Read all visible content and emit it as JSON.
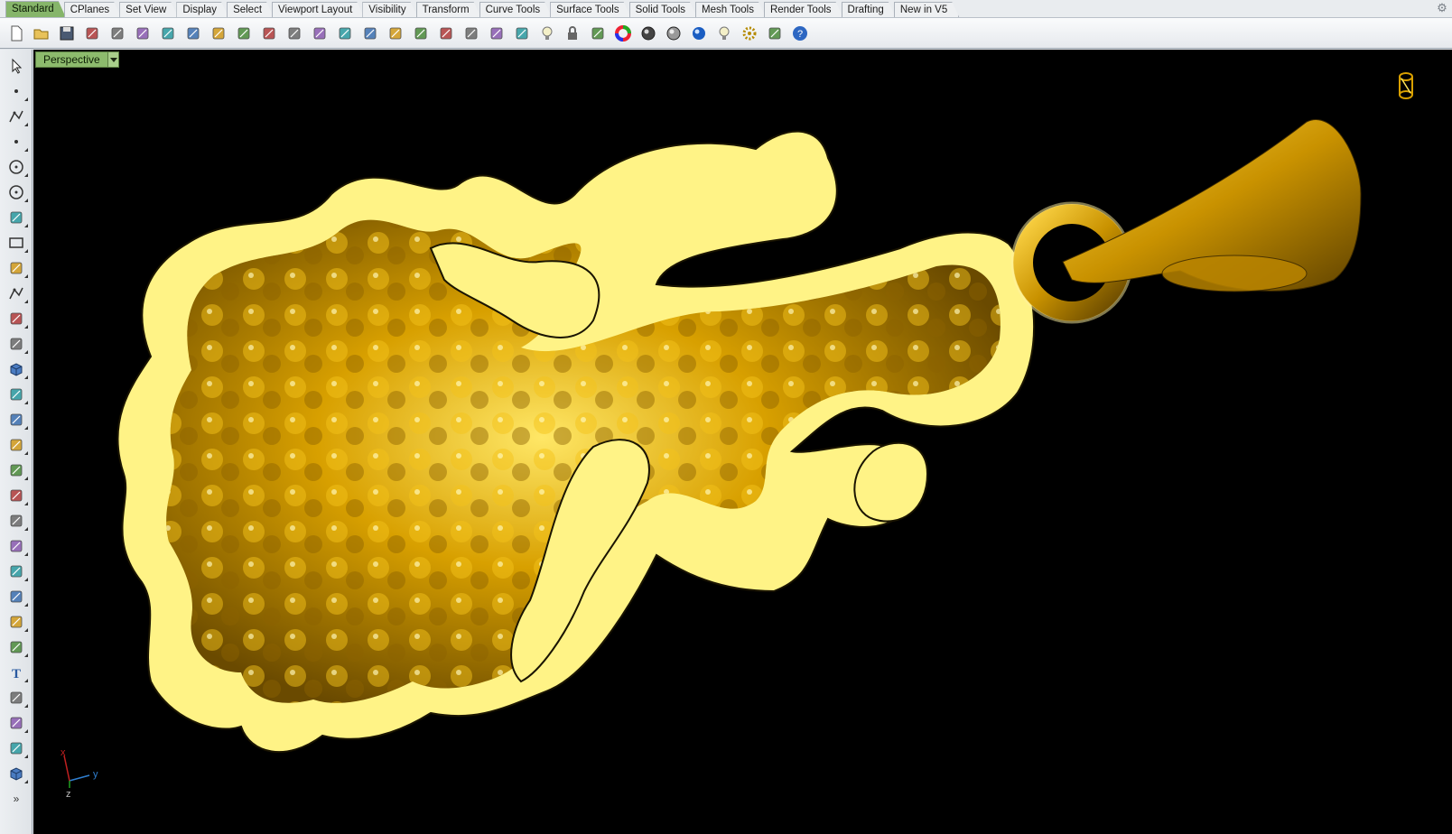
{
  "tabs": [
    "Standard",
    "CPlanes",
    "Set View",
    "Display",
    "Select",
    "Viewport Layout",
    "Visibility",
    "Transform",
    "Curve Tools",
    "Surface Tools",
    "Solid Tools",
    "Mesh Tools",
    "Render Tools",
    "Drafting",
    "New in V5"
  ],
  "active_tab": "Standard",
  "toolbar": {
    "icons": [
      "new-icon",
      "open-icon",
      "save-icon",
      "print-icon",
      "import-icon",
      "cut-icon",
      "copy-icon",
      "paste-icon",
      "undo-icon",
      "pan-hand-icon",
      "rotate-view-icon",
      "zoom-icon",
      "zoom-window-icon",
      "zoom-extents-icon",
      "zoom-selected-icon",
      "undo-view-icon",
      "four-viewports-icon",
      "car-render-icon",
      "hide-icon",
      "osnap-icon",
      "cplane-icon",
      "light-icon",
      "lock-icon",
      "layer-icon",
      "color-wheel-icon",
      "shaded-sphere-icon",
      "rendered-sphere-icon",
      "render-icon",
      "light-cone-icon",
      "options-gear-icon",
      "dimension-icon",
      "help-icon"
    ]
  },
  "left_tools": [
    "select-arrow-icon",
    "point-icon",
    "polyline-icon",
    "curve-points-icon",
    "circle-icon",
    "ellipse-icon",
    "arc-icon",
    "rectangle-icon",
    "polygon-icon",
    "freeform-curve-icon",
    "surface-patch-icon",
    "loft-icon",
    "box-icon",
    "boolean-icon",
    "cylinder-icon",
    "plane-surface-icon",
    "solid-tools-icon",
    "extract-icon",
    "trim-icon",
    "split-icon",
    "group-icon",
    "explode-icon",
    "fillet-icon",
    "offset-icon",
    "text-icon",
    "scale-icon",
    "array-icon",
    "flow-icon",
    "cube-icon",
    "more-icon"
  ],
  "viewport": {
    "label": "Perspective",
    "axis_labels": {
      "x": "x",
      "y": "y",
      "z": "z"
    }
  },
  "colors": {
    "accent_tab": "#86b56a",
    "viewport_bg": "#000000",
    "gold": "#d9a400",
    "rim": "#ffee88"
  }
}
